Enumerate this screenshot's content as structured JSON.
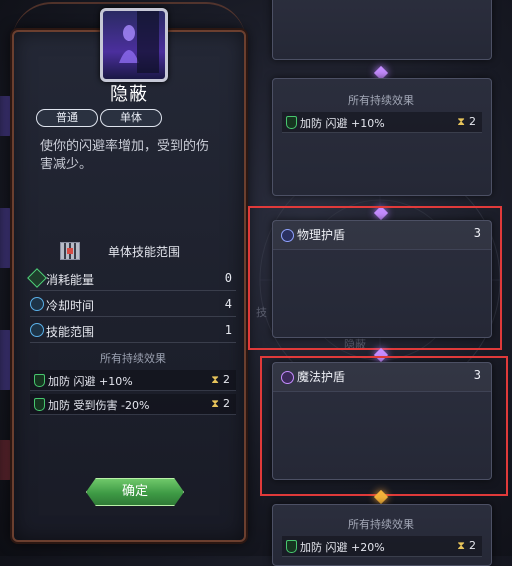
{
  "skill": {
    "name": "隐蔽",
    "tags": [
      "普通",
      "单体"
    ],
    "description": "使你的闪避率增加，受到的伤害减少。",
    "range_title": "单体技能范围",
    "stats": [
      {
        "icon": "energy-icon",
        "label": "消耗能量",
        "value": "0"
      },
      {
        "icon": "cooldown-icon",
        "label": "冷却时间",
        "value": "4"
      },
      {
        "icon": "range-icon",
        "label": "技能范围",
        "value": "1"
      }
    ],
    "effects_title": "所有持续效果",
    "effects": [
      {
        "label": "加防 闪避 +10%",
        "duration": "2"
      },
      {
        "label": "加防 受到伤害 -20%",
        "duration": "2"
      }
    ],
    "confirm_label": "确定"
  },
  "right_cards": {
    "top": {
      "effects_title": "所有持续效果",
      "effect": {
        "label": "加防 闪避 +10%",
        "duration": "2"
      }
    },
    "physical_shield": {
      "title": "物理护盾",
      "count": "3"
    },
    "magic_shield": {
      "title": "魔法护盾",
      "count": "3"
    },
    "bottom": {
      "effects_title": "所有持续效果",
      "effect": {
        "label": "加防 闪避 +20%",
        "duration": "2"
      }
    }
  },
  "background_fragments": {
    "skill_frag": "技",
    "hidden_frag": "隐蔽"
  },
  "colors": {
    "highlight": "#e03a3a",
    "confirm_green": "#3e9a45",
    "purple_gem": "#c58cff",
    "orange_gem": "#f4b23a"
  }
}
